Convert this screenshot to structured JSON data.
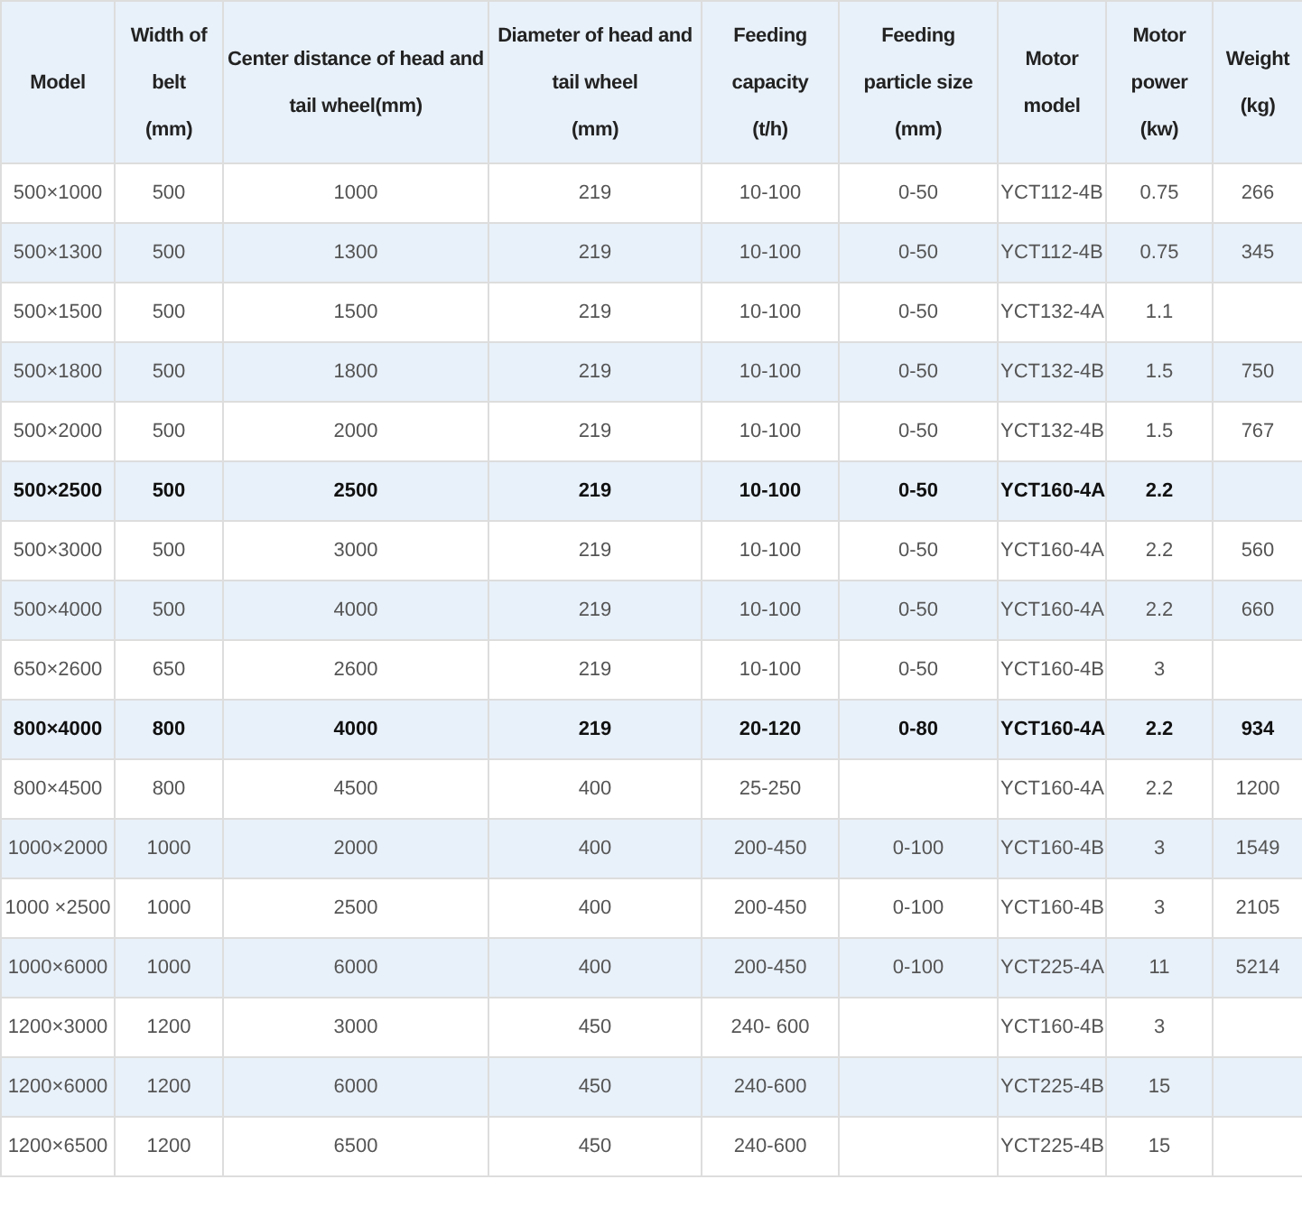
{
  "table": {
    "columns": [
      "Model",
      "Width of\nbelt\n(mm)",
      "Center distance of head and\ntail wheel(mm)",
      "Diameter of head and\ntail wheel\n(mm)",
      "Feeding\ncapacity\n(t/h)",
      "Feeding\nparticle size\n(mm)",
      "Motor\nmodel",
      "Motor\npower\n(kw)",
      "Weight\n(kg)"
    ],
    "rows": [
      {
        "bold": false,
        "cells": [
          "500×1000",
          "500",
          "1000",
          "219",
          "10-100",
          "0-50",
          "YCT112-4B",
          "0.75",
          "266"
        ]
      },
      {
        "bold": false,
        "cells": [
          "500×1300",
          "500",
          "1300",
          "219",
          "10-100",
          "0-50",
          "YCT112-4B",
          "0.75",
          "345"
        ]
      },
      {
        "bold": false,
        "cells": [
          "500×1500",
          "500",
          "1500",
          "219",
          "10-100",
          "0-50",
          "YCT132-4A",
          "1.1",
          null
        ]
      },
      {
        "bold": false,
        "cells": [
          "500×1800",
          "500",
          "1800",
          "219",
          "10-100",
          "0-50",
          "YCT132-4B",
          "1.5",
          "750"
        ]
      },
      {
        "bold": false,
        "cells": [
          "500×2000",
          "500",
          "2000",
          "219",
          "10-100",
          "0-50",
          "YCT132-4B",
          "1.5",
          "767"
        ]
      },
      {
        "bold": true,
        "cells": [
          "500×2500",
          "500",
          "2500",
          "219",
          "10-100",
          "0-50",
          "YCT160-4A",
          "2.2",
          null
        ]
      },
      {
        "bold": false,
        "cells": [
          "500×3000",
          "500",
          "3000",
          "219",
          "10-100",
          "0-50",
          "YCT160-4A",
          "2.2",
          "560"
        ]
      },
      {
        "bold": false,
        "cells": [
          "500×4000",
          "500",
          "4000",
          "219",
          "10-100",
          "0-50",
          "YCT160-4A",
          "2.2",
          "660"
        ]
      },
      {
        "bold": false,
        "cells": [
          "650×2600",
          "650",
          "2600",
          "219",
          "10-100",
          "0-50",
          "YCT160-4B",
          "3",
          null
        ]
      },
      {
        "bold": true,
        "cells": [
          "800×4000",
          "800",
          "4000",
          "219",
          "20-120",
          "0-80",
          "YCT160-4A",
          "2.2",
          "934"
        ]
      },
      {
        "bold": false,
        "cells": [
          "800×4500",
          "800",
          "4500",
          "400",
          "25-250",
          null,
          "YCT160-4A",
          "2.2",
          "1200"
        ]
      },
      {
        "bold": false,
        "cells": [
          "1000×2000",
          "1000",
          "2000",
          "400",
          "200-450",
          "0-100",
          "YCT160-4B",
          "3",
          "1549"
        ]
      },
      {
        "bold": false,
        "cells": [
          "1000 ×2500",
          "1000",
          "2500",
          "400",
          "200-450",
          "0-100",
          "YCT160-4B",
          "3",
          "2105"
        ]
      },
      {
        "bold": false,
        "cells": [
          "1000×6000",
          "1000",
          "6000",
          "400",
          "200-450",
          "0-100",
          "YCT225-4A",
          "11",
          "5214"
        ]
      },
      {
        "bold": false,
        "cells": [
          "1200×3000",
          "1200",
          "3000",
          "450",
          "240- 600",
          null,
          "YCT160-4B",
          "3",
          null
        ]
      },
      {
        "bold": false,
        "cells": [
          "1200×6000",
          "1200",
          "6000",
          "450",
          "240-600",
          null,
          "YCT225-4B",
          "15",
          null
        ]
      },
      {
        "bold": false,
        "cells": [
          "1200×6500",
          "1200",
          "6500",
          "450",
          "240-600",
          null,
          "YCT225-4B",
          "15",
          null
        ]
      }
    ]
  }
}
